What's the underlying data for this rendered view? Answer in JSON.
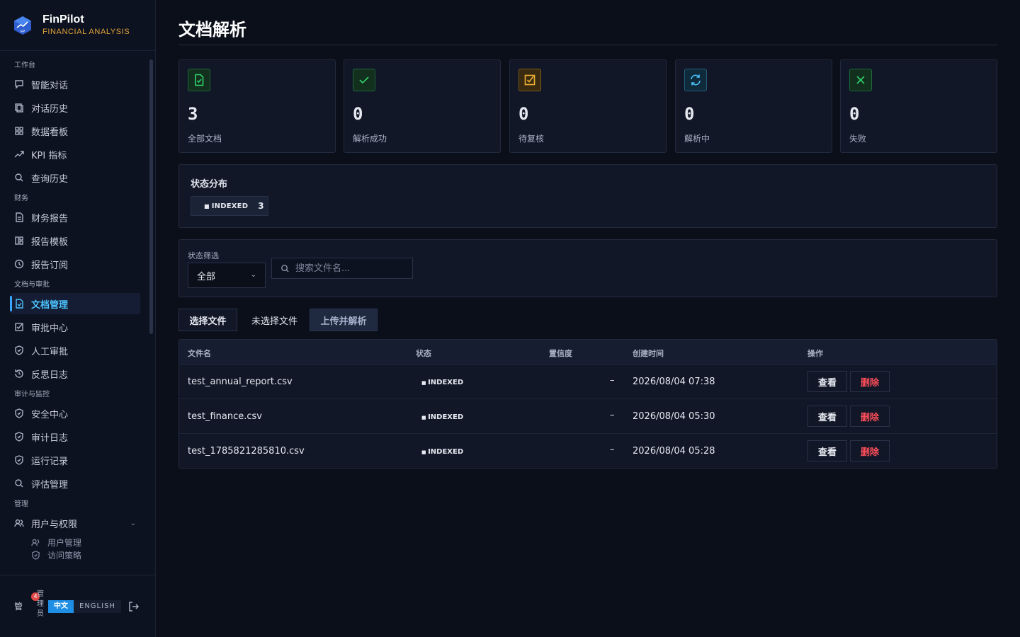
{
  "brand": {
    "name": "FinPilot",
    "subtitle": "FINANCIAL ANALYSIS",
    "logo_text": "FP"
  },
  "sidebar": {
    "sections": [
      {
        "title": "工作台",
        "items": [
          {
            "label": "智能对话",
            "icon": "chat-icon"
          },
          {
            "label": "对话历史",
            "icon": "history-icon"
          },
          {
            "label": "数据看板",
            "icon": "dashboard-icon"
          },
          {
            "label": "KPI 指标",
            "icon": "trend-icon"
          },
          {
            "label": "查询历史",
            "icon": "search-icon"
          }
        ]
      },
      {
        "title": "财务",
        "items": [
          {
            "label": "财务报告",
            "icon": "document-icon"
          },
          {
            "label": "报告模板",
            "icon": "template-icon"
          },
          {
            "label": "报告订阅",
            "icon": "clock-icon"
          }
        ]
      },
      {
        "title": "文档与审批",
        "items": [
          {
            "label": "文档管理",
            "icon": "file-check-icon",
            "active": true
          },
          {
            "label": "审批中心",
            "icon": "checkbox-icon"
          },
          {
            "label": "人工审批",
            "icon": "shield-icon"
          },
          {
            "label": "反思日志",
            "icon": "rewind-icon"
          }
        ]
      },
      {
        "title": "审计与监控",
        "items": [
          {
            "label": "安全中心",
            "icon": "shield-icon"
          },
          {
            "label": "审计日志",
            "icon": "shield-icon"
          },
          {
            "label": "运行记录",
            "icon": "shield-icon"
          },
          {
            "label": "评估管理",
            "icon": "search-icon"
          }
        ]
      },
      {
        "title": "管理",
        "items": [
          {
            "label": "用户与权限",
            "icon": "users-icon",
            "expandable": true
          }
        ]
      }
    ],
    "sub_items": [
      {
        "label": "用户管理",
        "icon": "users-icon"
      },
      {
        "label": "访问策略",
        "icon": "shield-icon"
      }
    ],
    "footer": {
      "avatar_text": "管",
      "badge_count": "4",
      "user_name": "管理员",
      "lang_zh": "中文",
      "lang_en": "ENGLISH"
    }
  },
  "page": {
    "title": "文档解析"
  },
  "stats": [
    {
      "value": "3",
      "label": "全部文档",
      "icon": "file-check-icon",
      "color": "#2fd36b",
      "bg": "#13301f"
    },
    {
      "value": "0",
      "label": "解析成功",
      "icon": "check-icon",
      "color": "#2fd36b",
      "bg": "#13301f"
    },
    {
      "value": "0",
      "label": "待复核",
      "icon": "checkbox-icon",
      "color": "#f2b233",
      "bg": "#3a2b10"
    },
    {
      "value": "0",
      "label": "解析中",
      "icon": "refresh-icon",
      "color": "#4cc3ff",
      "bg": "#0f2a3a"
    },
    {
      "value": "0",
      "label": "失败",
      "icon": "close-icon",
      "color": "#2fd36b",
      "bg": "#13301f"
    }
  ],
  "distribution": {
    "title": "状态分布",
    "status": "INDEXED",
    "count": "3"
  },
  "filter": {
    "label": "状态筛选",
    "selected": "全部",
    "search_placeholder": "搜索文件名..."
  },
  "upload": {
    "select_label": "选择文件",
    "no_file_label": "未选择文件",
    "upload_label": "上传并解析"
  },
  "table": {
    "headers": [
      "文件名",
      "状态",
      "置信度",
      "创建时间",
      "操作"
    ],
    "rows": [
      {
        "name": "test_annual_report.csv",
        "status": "INDEXED",
        "confidence": "–",
        "created": "2026/08/04 07:38"
      },
      {
        "name": "test_finance.csv",
        "status": "INDEXED",
        "confidence": "–",
        "created": "2026/08/04 05:30"
      },
      {
        "name": "test_1785821285810.csv",
        "status": "INDEXED",
        "confidence": "–",
        "created": "2026/08/04 05:28"
      }
    ],
    "view_label": "查看",
    "delete_label": "删除"
  }
}
